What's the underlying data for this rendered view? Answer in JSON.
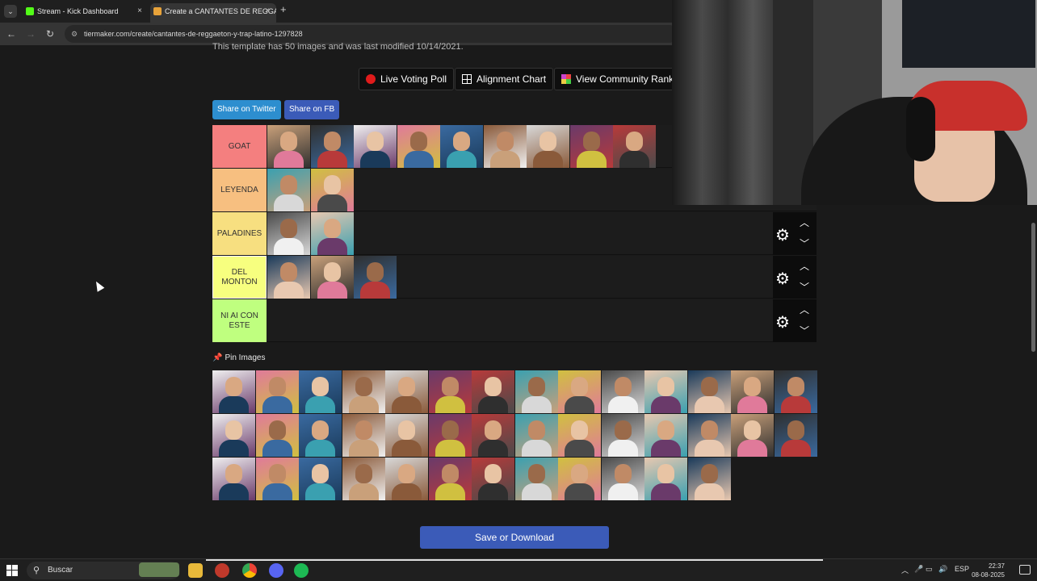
{
  "browser": {
    "tabs": [
      {
        "label": "Stream - Kick Dashboard",
        "active": false,
        "favicon_color": "#53fc18"
      },
      {
        "label": "Create a CANTANTES DE REGGAETON",
        "active": true,
        "favicon_color": "#e8a33a"
      }
    ],
    "new_tab": "+",
    "tab_menu": "⌄",
    "url": "tiermaker.com/create/cantantes-de-reggaeton-y-trap-latino-1297828"
  },
  "page": {
    "meta_text": "This template has 50 images and was last modified 10/14/2021.",
    "buttons": {
      "live_voting": "Live Voting Poll",
      "alignment": "Alignment Chart",
      "community": "View Community Rank"
    },
    "share_twitter": "Share on Twitter",
    "share_fb": "Share on FB",
    "tiers": [
      {
        "label": "GOAT",
        "color": "#f47f7f",
        "count": 9
      },
      {
        "label": "LEYENDA",
        "color": "#f7bf80",
        "count": 2
      },
      {
        "label": "PALADINES",
        "color": "#f7df80",
        "count": 2
      },
      {
        "label": "DEL MONTON",
        "color": "#f7ff7f",
        "count": 3
      },
      {
        "label": "NI AI CON ESTE",
        "color": "#bfff7f",
        "count": 0
      }
    ],
    "pin_label": "Pin Images",
    "pool_count": 40,
    "save_label": "Save or Download"
  },
  "taskbar": {
    "search_placeholder": "Buscar",
    "language": "ESP",
    "time": "22:37",
    "date": "08-08-2025"
  }
}
